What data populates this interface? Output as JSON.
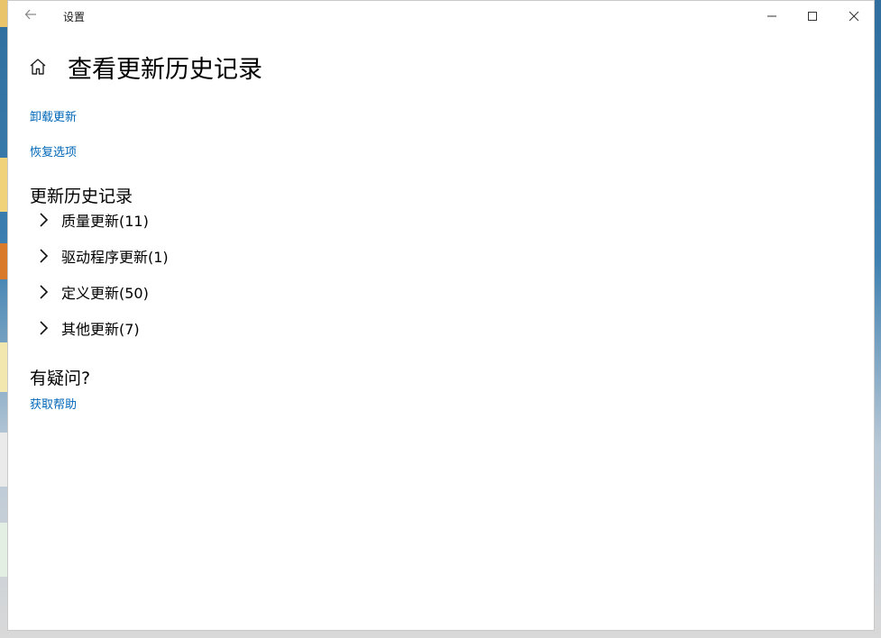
{
  "window": {
    "app_title": "设置"
  },
  "page": {
    "title": "查看更新历史记录"
  },
  "links": {
    "uninstall_updates": "卸载更新",
    "recovery_options": "恢复选项",
    "get_help": "获取帮助"
  },
  "history": {
    "heading": "更新历史记录",
    "groups": [
      {
        "label": "质量更新(11)"
      },
      {
        "label": "驱动程序更新(1)"
      },
      {
        "label": "定义更新(50)"
      },
      {
        "label": "其他更新(7)"
      }
    ]
  },
  "help": {
    "heading": "有疑问?"
  },
  "colors": {
    "link": "#0067b8",
    "text": "#000000",
    "window_bg": "#ffffff"
  }
}
